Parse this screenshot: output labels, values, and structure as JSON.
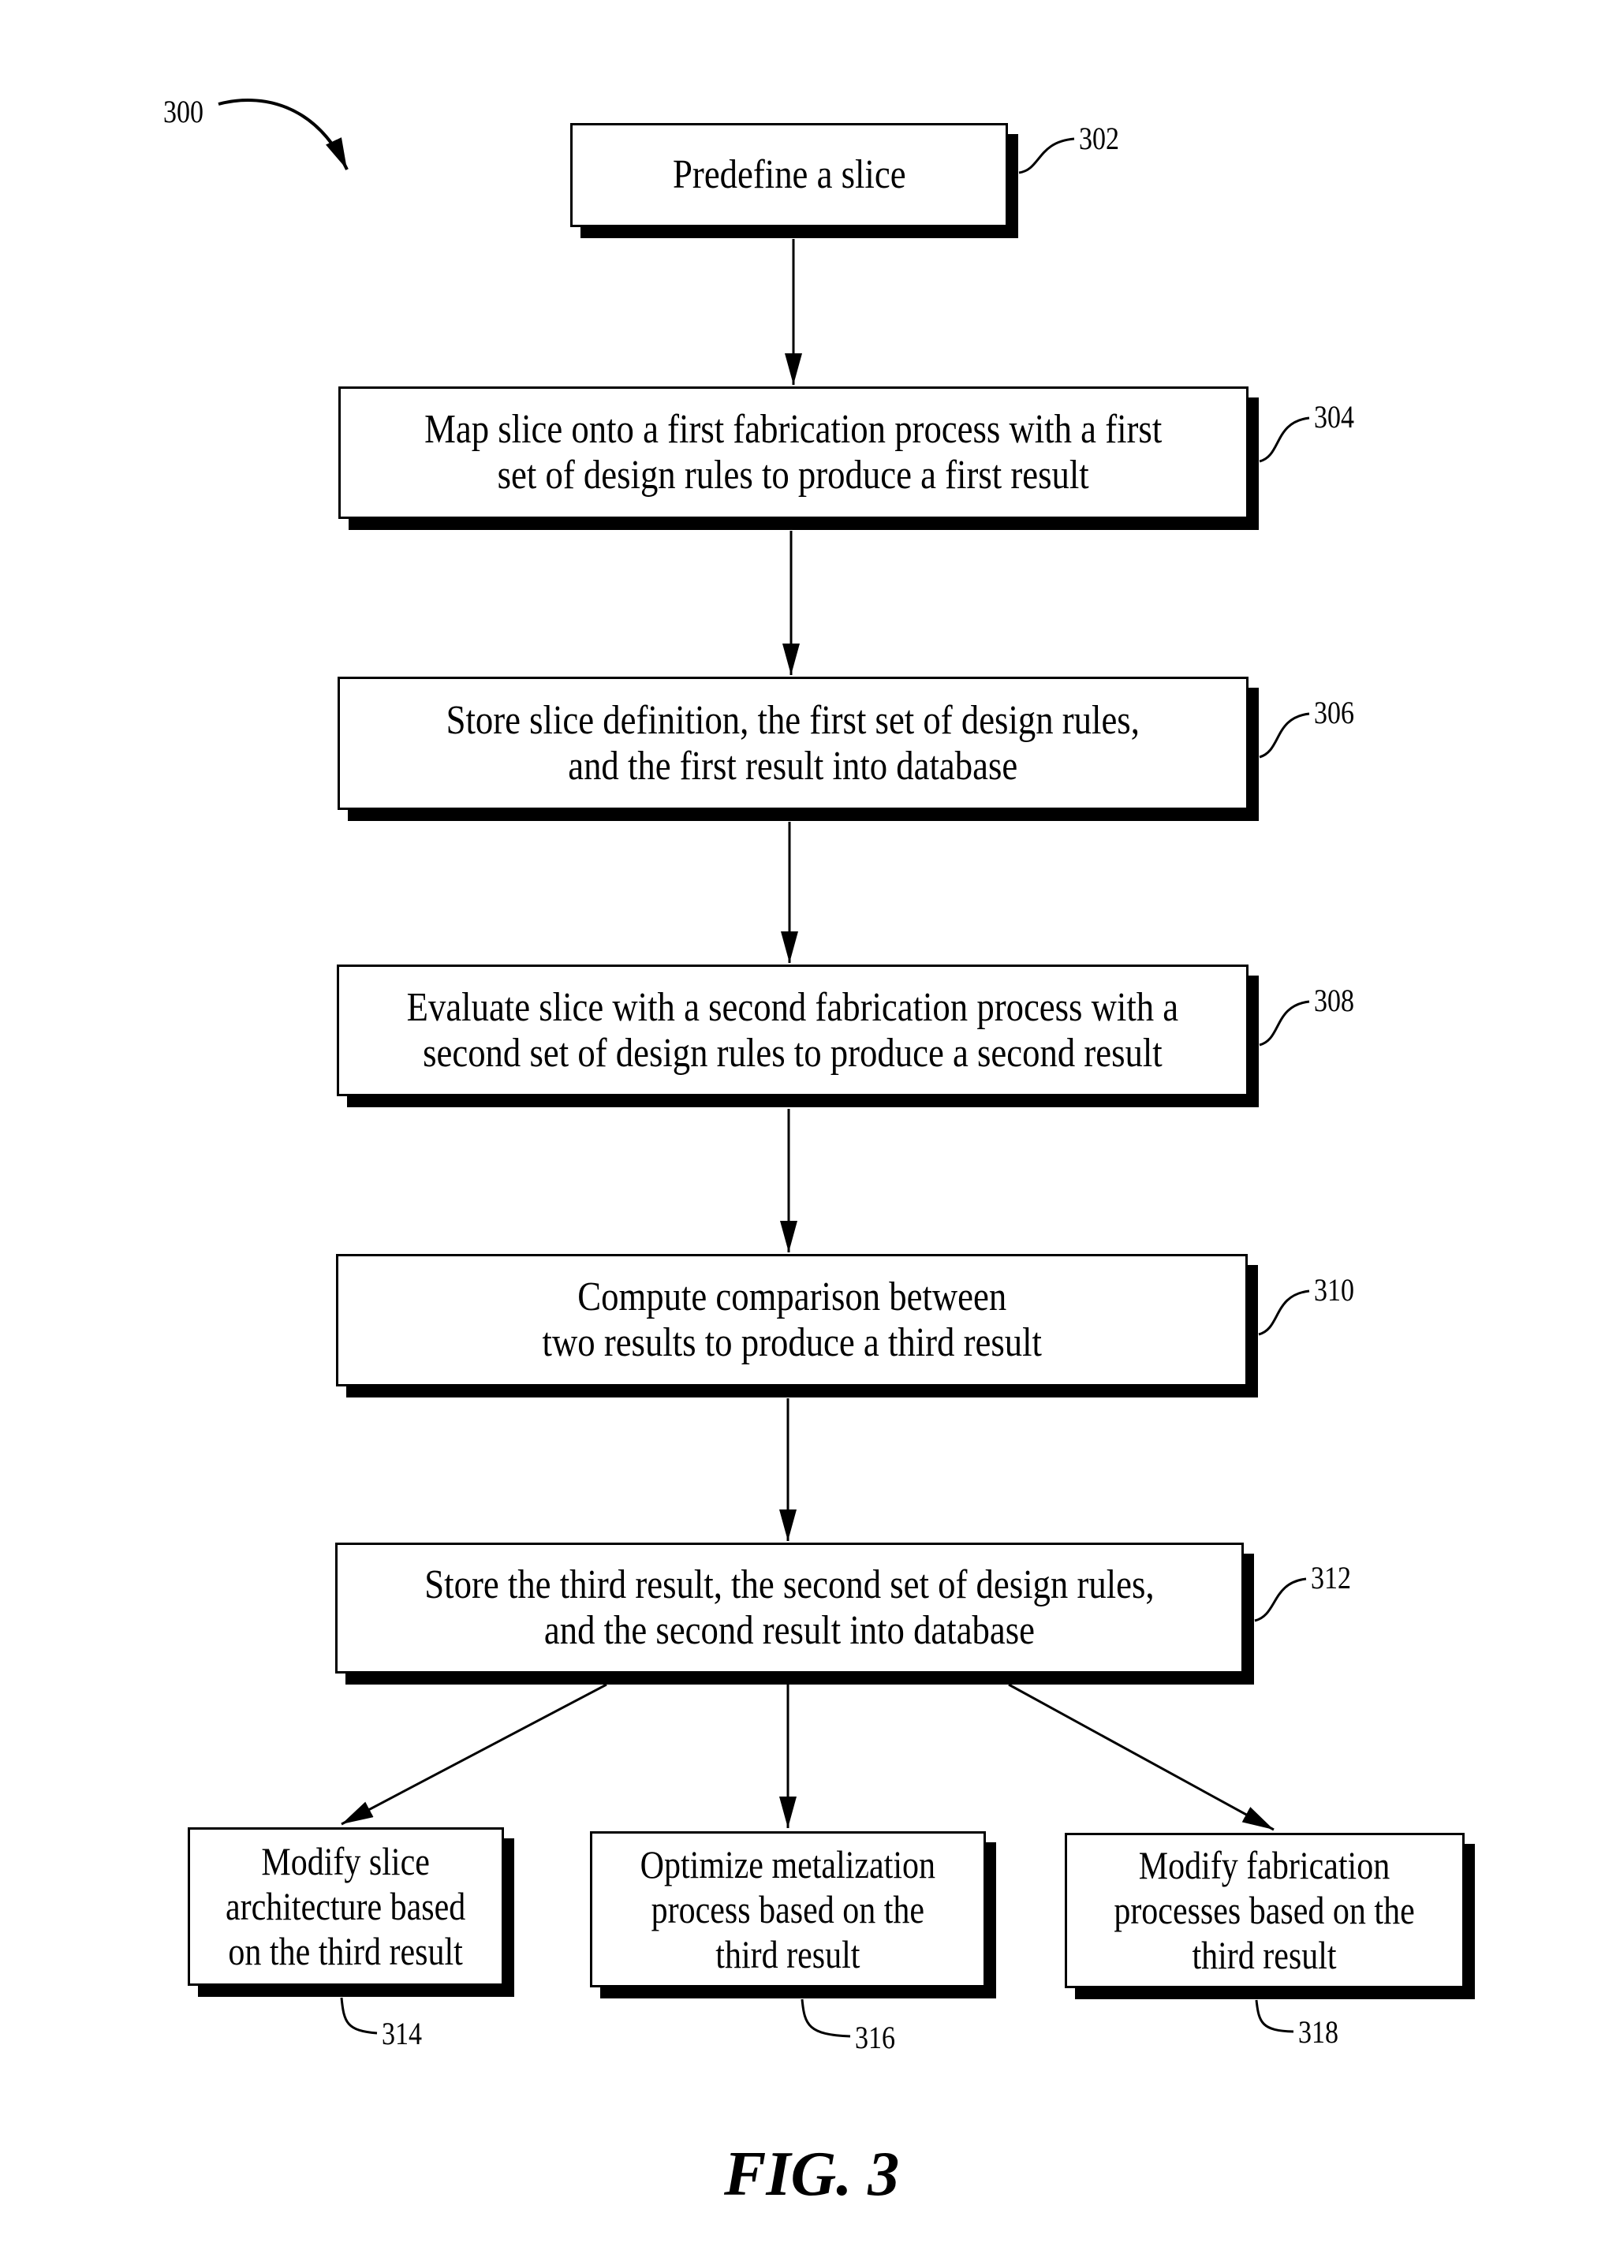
{
  "figure": {
    "caption": "FIG. 3",
    "reference": "300"
  },
  "steps": [
    {
      "id": "302",
      "lines": [
        "Predefine a slice"
      ]
    },
    {
      "id": "304",
      "lines": [
        "Map slice onto a first fabrication process with a first",
        "set of design rules to produce a first result"
      ]
    },
    {
      "id": "306",
      "lines": [
        "Store slice definition, the first set of design rules,",
        "and the first result into database"
      ]
    },
    {
      "id": "308",
      "lines": [
        "Evaluate slice with a second fabrication process with a",
        "second set of design rules to produce a second result"
      ]
    },
    {
      "id": "310",
      "lines": [
        "Compute comparison between",
        "two results to produce a third result"
      ]
    },
    {
      "id": "312",
      "lines": [
        "Store the third result, the second set of design rules,",
        "and the second result into database"
      ]
    },
    {
      "id": "314",
      "lines": [
        "Modify slice",
        "architecture based",
        "on the third result"
      ]
    },
    {
      "id": "316",
      "lines": [
        "Optimize metalization",
        "process based on the",
        "third result"
      ]
    },
    {
      "id": "318",
      "lines": [
        "Modify fabrication",
        "processes based on the",
        "third result"
      ]
    }
  ],
  "edges": [
    [
      "302",
      "304"
    ],
    [
      "304",
      "306"
    ],
    [
      "306",
      "308"
    ],
    [
      "308",
      "310"
    ],
    [
      "310",
      "312"
    ],
    [
      "312",
      "314"
    ],
    [
      "312",
      "316"
    ],
    [
      "312",
      "318"
    ]
  ]
}
